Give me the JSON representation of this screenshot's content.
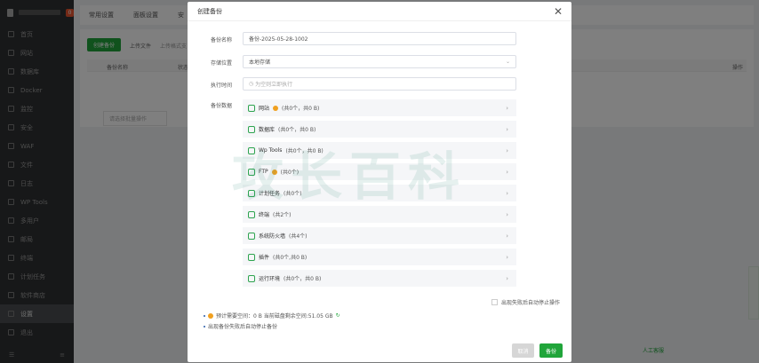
{
  "sidebar": {
    "badge": "0",
    "items": [
      {
        "label": "首页"
      },
      {
        "label": "网站"
      },
      {
        "label": "数据库"
      },
      {
        "label": "Docker"
      },
      {
        "label": "监控"
      },
      {
        "label": "安全"
      },
      {
        "label": "WAF"
      },
      {
        "label": "文件"
      },
      {
        "label": "日志"
      },
      {
        "label": "WP Tools"
      },
      {
        "label": "多用户"
      },
      {
        "label": "邮局"
      },
      {
        "label": "终端"
      },
      {
        "label": "计划任务"
      },
      {
        "label": "软件商店"
      },
      {
        "label": "设置"
      },
      {
        "label": "退出"
      }
    ]
  },
  "background": {
    "tabs": [
      "常用设置",
      "面板设置",
      "安"
    ],
    "create_backup_btn": "创建备份",
    "upload_file": "上传文件",
    "upload_hint": "上传格式支",
    "col_name": "备份名称",
    "col_status": "状态",
    "col_action": "操作",
    "select_placeholder": "请选择批量操作",
    "bottom_link": "人工客服"
  },
  "dialog": {
    "title": "创建备份",
    "labels": {
      "name": "备份名称",
      "location": "存储位置",
      "time": "执行时间",
      "data": "备份数据"
    },
    "name_value": "备份-2025-05-28-1002",
    "location_value": "本地存储",
    "time_placeholder": "为空则立即执行",
    "items": [
      {
        "name": "网站",
        "detail": "(共0个，共0 B)",
        "warn": true
      },
      {
        "name": "数据库",
        "detail": "(共0个，共0 B)",
        "warn": false
      },
      {
        "name": "Wp Tools",
        "detail": "(共0个，共0 B)",
        "warn": false
      },
      {
        "name": "FTP",
        "detail": "(共0个)",
        "warn": true
      },
      {
        "name": "计划任务",
        "detail": "(共0个)",
        "warn": false
      },
      {
        "name": "终端",
        "detail": "(共2个)",
        "warn": false
      },
      {
        "name": "系统防火墙",
        "detail": "(共4个)",
        "warn": false
      },
      {
        "name": "插件",
        "detail": "(共0个,共0 B)",
        "warn": false
      },
      {
        "name": "运行环境",
        "detail": "(共0个，共0 B)",
        "warn": false
      }
    ],
    "stop_on_fail": "出现失败后自动停止操作",
    "note1": "预计需要空间：0 B 当前磁盘剩余空间:51.05 GB",
    "note2": "出现备份失败后自动停止备份",
    "cancel": "取消",
    "confirm": "备份",
    "watermark": "攻长百科"
  }
}
